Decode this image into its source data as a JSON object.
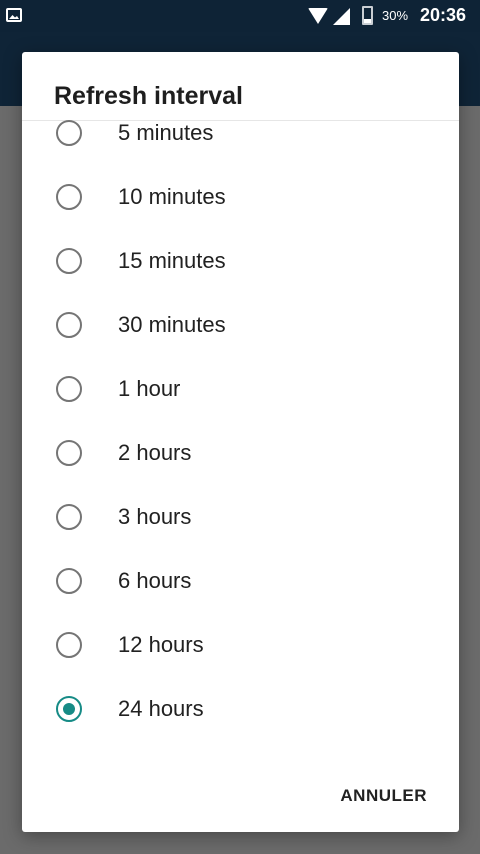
{
  "status_bar": {
    "battery": "30%",
    "time": "20:36",
    "icons": [
      "image-notification-icon",
      "wifi-icon",
      "signal-icon",
      "battery-icon"
    ]
  },
  "dialog": {
    "title": "Refresh interval",
    "options": [
      {
        "label": "5 minutes",
        "selected": false
      },
      {
        "label": "10 minutes",
        "selected": false
      },
      {
        "label": "15 minutes",
        "selected": false
      },
      {
        "label": "30 minutes",
        "selected": false
      },
      {
        "label": "1 hour",
        "selected": false
      },
      {
        "label": "2 hours",
        "selected": false
      },
      {
        "label": "3 hours",
        "selected": false
      },
      {
        "label": "6 hours",
        "selected": false
      },
      {
        "label": "12 hours",
        "selected": false
      },
      {
        "label": "24 hours",
        "selected": true
      }
    ],
    "cancel_label": "ANNULER"
  },
  "colors": {
    "accent": "#168b86",
    "status_bar": "#0e2336",
    "scrim": "#6b6b6b"
  }
}
